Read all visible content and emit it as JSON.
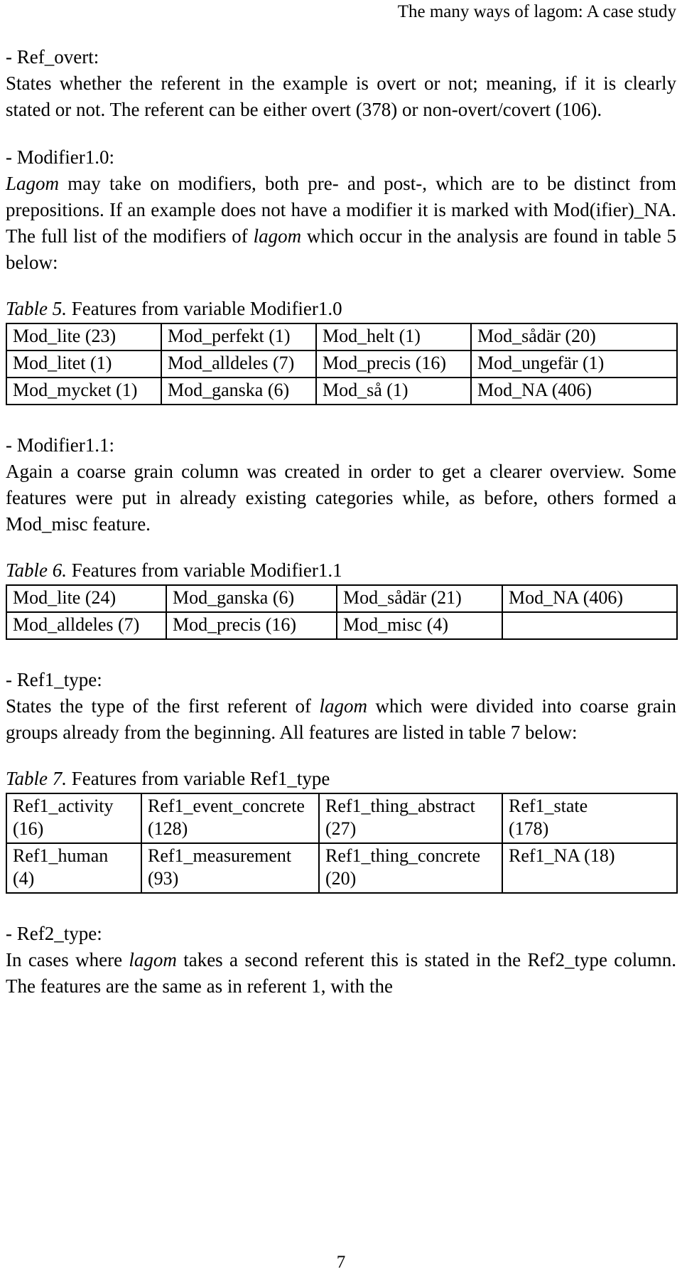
{
  "header": {
    "running_title": "The many ways of lagom: A case study"
  },
  "footer": {
    "page_number": "7"
  },
  "sections": {
    "ref_overt": {
      "heading": "- Ref_overt:",
      "body_part1": "States whether the referent in the example is overt or not; meaning, if it is clearly stated or not. The referent can be either overt (378) or non-overt/covert (106)."
    },
    "modifier10": {
      "heading": "- Modifier1.0:",
      "body_lead_italic": "Lagom",
      "body_part1": " may take on modifiers, both pre- and post-, which are to be distinct from prepositions. If an example does not have a modifier it is marked with Mod(ifier)_NA. The full list of the modifiers of ",
      "body_italic2": "lagom",
      "body_part2": " which occur in the analysis are found in table 5 below:"
    },
    "modifier11": {
      "heading": "- Modifier1.1:",
      "body_part1": "Again a coarse grain column was created in order to get a clearer overview. Some features were put in already existing categories while, as before, others formed a Mod_misc feature."
    },
    "ref1_type": {
      "heading": "- Ref1_type:",
      "body_part1": "States the type of the first referent of ",
      "body_italic1": "lagom",
      "body_part2": " which were divided into coarse grain groups already from the beginning. All features are listed in table 7 below:"
    },
    "ref2_type": {
      "heading": "- Ref2_type:",
      "body_part1": "In cases where ",
      "body_italic1": "lagom",
      "body_part2": " takes a second referent this is stated in the Ref2_type column. The features are the same as in referent 1, with the"
    }
  },
  "tables": {
    "table5": {
      "caption_label": "Table 5.",
      "caption_text": " Features from variable Modifier1.0",
      "rows": [
        [
          "Mod_lite (23)",
          "Mod_perfekt (1)",
          "Mod_helt (1)",
          "Mod_sådär (20)"
        ],
        [
          "Mod_litet (1)",
          "Mod_alldeles (7)",
          "Mod_precis (16)",
          "Mod_ungefär (1)"
        ],
        [
          "Mod_mycket (1)",
          "Mod_ganska (6)",
          "Mod_så (1)",
          "Mod_NA (406)"
        ]
      ]
    },
    "table6": {
      "caption_label": "Table 6.",
      "caption_text": " Features from variable Modifier1.1",
      "rows": [
        [
          "Mod_lite (24)",
          "Mod_ganska (6)",
          "Mod_sådär (21)",
          "Mod_NA (406)"
        ],
        [
          "Mod_alldeles (7)",
          "Mod_precis (16)",
          "Mod_misc (4)",
          ""
        ]
      ]
    },
    "table7": {
      "caption_label": "Table 7.",
      "caption_text": " Features from variable Ref1_type",
      "rows": [
        [
          {
            "name": "Ref1_activity",
            "count": "(16)"
          },
          {
            "name": "Ref1_event_concrete",
            "count": "(128)"
          },
          {
            "name": "Ref1_thing_abstract",
            "count": "(27)"
          },
          {
            "name": "Ref1_state",
            "count": "(178)"
          }
        ],
        [
          {
            "name": "Ref1_human",
            "count": "(4)"
          },
          {
            "name": "Ref1_measurement",
            "count": "(93)"
          },
          {
            "name": "Ref1_thing_concrete",
            "count": "(20)"
          },
          {
            "name": "Ref1_NA (18)",
            "count": ""
          }
        ]
      ]
    }
  }
}
